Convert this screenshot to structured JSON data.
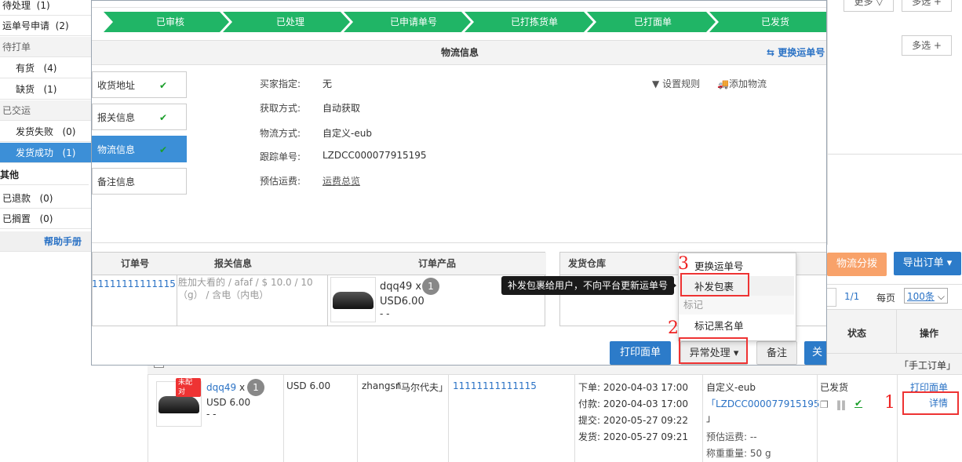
{
  "sidebar": {
    "items": [
      {
        "label": "待处理",
        "count": "(1)"
      },
      {
        "label": "运单号申请",
        "count": "(2)"
      },
      {
        "label": "待打单",
        "count": ""
      },
      {
        "label": "有货",
        "count": "(4)"
      },
      {
        "label": "缺货",
        "count": "(1)"
      },
      {
        "label": "已交运",
        "count": ""
      },
      {
        "label": "发货失败",
        "count": "(0)"
      },
      {
        "label": "发货成功",
        "count": "(1)"
      },
      {
        "label": "其他",
        "count": ""
      },
      {
        "label": "已退款",
        "count": "(0)"
      },
      {
        "label": "已搁置",
        "count": "(0)"
      }
    ],
    "help": "帮助手册"
  },
  "right_top": {
    "more": "更多",
    "multi1": "多选 +",
    "multi2": "多选 +"
  },
  "modal": {
    "steps": [
      "已审核",
      "已处理",
      "已申请单号",
      "已打拣货单",
      "已打面单",
      "已发货"
    ],
    "section_title": "物流信息",
    "change_tracking": "更换运单号",
    "tabs": [
      "收货地址",
      "报关信息",
      "物流信息",
      "备注信息"
    ],
    "fields": [
      {
        "label": "买家指定:",
        "value": "无"
      },
      {
        "label": "获取方式:",
        "value": "自动获取"
      },
      {
        "label": "物流方式:",
        "value": "自定义-eub"
      },
      {
        "label": "跟踪单号:",
        "value": "LZDCC000077915195"
      },
      {
        "label": "预估运费:",
        "value": "运费总览"
      }
    ],
    "set_rule": "设置规则",
    "add_logistics": "添加物流",
    "table_headers": [
      "订单号",
      "报关信息",
      "订单产品",
      "发货仓库"
    ],
    "row": {
      "order_no": "11111111111115",
      "customs": "胜加大看的 / afaf / $ 10.0 / 10 （g） / 含电（内电）",
      "product_name": "dqq49 x",
      "qty": "1",
      "price": "USD6.00",
      "dash": "- -"
    },
    "buttons": {
      "print": "打印面单",
      "exception": "异常处理",
      "note": "备注",
      "close": "关"
    }
  },
  "dropdown": {
    "items": [
      "更换运单号",
      "补发包裹"
    ],
    "group": "标记",
    "blacklist": "标记黑名单",
    "tooltip": "补发包裹给用户，不向平台更新运单号"
  },
  "annotations": [
    "1",
    "2",
    "3"
  ],
  "toolbar": {
    "logistics_split": "物流分拨",
    "export": "导出订单"
  },
  "pager": {
    "page": "1/1",
    "per_page_label": "每页",
    "per_page_value": "100条"
  },
  "bg_table": {
    "col_status": "状态",
    "col_action": "操作",
    "manual_order": "「手工订单」",
    "tag": "未配对",
    "product": "dqq49",
    "product_x": "x",
    "qty": "1",
    "price": "USD 6.00",
    "dash": "- -",
    "amount": "USD 6.00",
    "buyer": "zhangsn",
    "buyer_country": "「马尔代夫」",
    "order_no": "11111111111115",
    "times": [
      "下单: 2020-04-03 17:00",
      "付款: 2020-04-03 17:00",
      "提交: 2020-05-27 09:22",
      "发货: 2020-05-27 09:21"
    ],
    "logistics": "自定义-eub",
    "tracking": "「LZDCC000077915195",
    "tracking_end": "」",
    "est_fee": "预估运费: --",
    "weight": "称重重量: 50 g",
    "status": "已发货",
    "print_label": "打印面单",
    "detail": "详情"
  },
  "colors": {
    "step_green": "#20b566",
    "accent_blue": "#3c8fd7",
    "annotation_red": "#e33333"
  }
}
